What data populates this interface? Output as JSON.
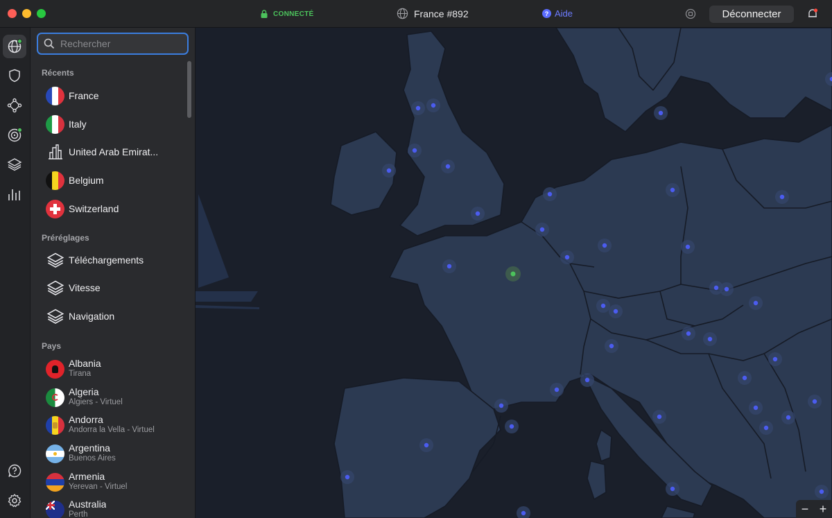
{
  "titlebar": {
    "status": "CONNECTÉ",
    "server": "France #892",
    "help": "Aide",
    "disconnect": "Déconnecter",
    "icons": [
      "lock-icon",
      "globe-icon",
      "help-icon",
      "quick-connect-icon",
      "bell-icon"
    ]
  },
  "rail": {
    "items": [
      "globe-icon",
      "shield-icon",
      "meshnet-icon",
      "target-icon",
      "layers-icon",
      "stats-icon",
      "help-icon",
      "settings-icon"
    ]
  },
  "search": {
    "placeholder": "Rechercher"
  },
  "sections": {
    "recent": "Récents",
    "presets": "Préréglages",
    "countries": "Pays"
  },
  "recents": [
    {
      "label": "France"
    },
    {
      "label": "Italy"
    },
    {
      "label": "United Arab Emirat..."
    },
    {
      "label": "Belgium"
    },
    {
      "label": "Switzerland"
    }
  ],
  "presets": [
    {
      "label": "Téléchargements"
    },
    {
      "label": "Vitesse"
    },
    {
      "label": "Navigation"
    }
  ],
  "countries": [
    {
      "label": "Albania",
      "sub": "Tirana"
    },
    {
      "label": "Algeria",
      "sub": "Algiers - Virtuel"
    },
    {
      "label": "Andorra",
      "sub": "Andorra la Vella - Virtuel"
    },
    {
      "label": "Argentina",
      "sub": "Buenos Aires"
    },
    {
      "label": "Armenia",
      "sub": "Yerevan - Virtuel"
    },
    {
      "label": "Australia",
      "sub": "Perth"
    }
  ],
  "map": {
    "zoom_out": "−",
    "zoom_in": "+"
  },
  "colors": {
    "connected": "#4cc35c",
    "accent": "#3b7ee0",
    "server_dot": "#4b5cf0",
    "land": "#2c3a52",
    "sea": "#1a1f2a"
  }
}
